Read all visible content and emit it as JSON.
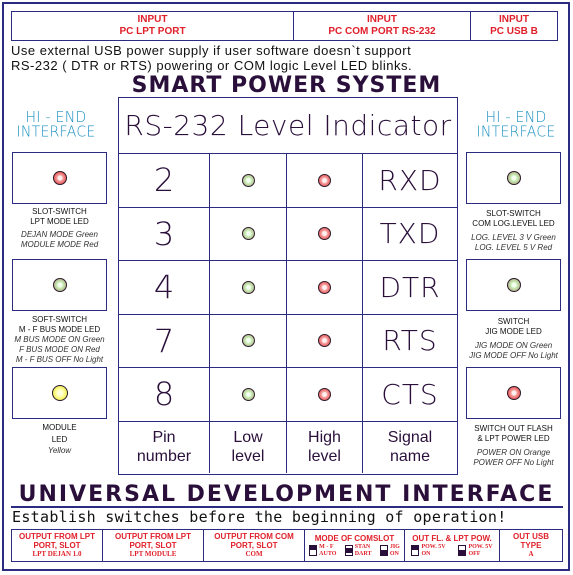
{
  "inputs": [
    {
      "line1": "INPUT",
      "line2": "PC LPT PORT"
    },
    {
      "line1": "INPUT",
      "line2": "PC  COM  PORT RS-232"
    },
    {
      "line1": "INPUT",
      "line2": "PC USB B"
    }
  ],
  "note": {
    "line1": "Use external USB power supply if user software doesn`t support",
    "line2": "RS-232 ( DTR or RTS)  powering or COM logic Level LED blinks."
  },
  "title": "SMART POWER SYSTEM",
  "brand_left": {
    "line1": "HI - END",
    "line2": "INTERFACE"
  },
  "brand_right": {
    "line1": "HI - END",
    "line2": "INTERFACE"
  },
  "left_panels": [
    {
      "led_color": "red",
      "title1": "SLOT-SWITCH",
      "title2": "LPT MODE LED",
      "desc": [
        "DEJAN MODE Green",
        "MODULE MODE Red"
      ]
    },
    {
      "led_color": "green",
      "title1": "SOFT-SWITCH",
      "title2": "M - F BUS MODE LED",
      "desc": [
        "M BUS MODE ON Green",
        "F BUS MODE ON Red",
        "M - F BUS OFF No Light"
      ]
    },
    {
      "led_color": "yellow",
      "title1": "MODULE",
      "title2": "LED",
      "desc": [
        "Yellow"
      ]
    }
  ],
  "right_panels": [
    {
      "led_color": "green",
      "title1": "SLOT-SWITCH",
      "title2": "COM LOG.LEVEL LED",
      "desc": [
        "LOG. LEVEL 3 V Green",
        "LOG. LEVEL 5 V Red"
      ]
    },
    {
      "led_color": "green",
      "title1": "SWITCH",
      "title2": "JIG MODE LED",
      "desc": [
        "JIG MODE ON  Green",
        "JIG MODE  OFF No Light"
      ]
    },
    {
      "led_color": "red",
      "title1": "SWITCH OUT FLASH",
      "title2": "& LPT POWER LED",
      "desc": [
        "POWER ON Orange",
        "POWER OFF No Light"
      ]
    }
  ],
  "indicator": {
    "title": "RS-232 Level Indicator",
    "rows": [
      {
        "pin": "2",
        "signal": "RXD"
      },
      {
        "pin": "3",
        "signal": "TXD"
      },
      {
        "pin": "4",
        "signal": "DTR"
      },
      {
        "pin": "7",
        "signal": "RTS"
      },
      {
        "pin": "8",
        "signal": "CTS"
      }
    ],
    "footer": {
      "pin": {
        "l1": "Pin",
        "l2": "number"
      },
      "low": {
        "l1": "Low",
        "l2": "level"
      },
      "high": {
        "l1": "High",
        "l2": "level"
      },
      "signal": {
        "l1": "Signal",
        "l2": "name"
      }
    }
  },
  "subtitle": "UNIVERSAL DEVELOPMENT INTERFACE",
  "warning": "Establish switches before the beginning of operation!",
  "outputs": [
    {
      "l1": "OUTPUT FROM  LPT",
      "l2": "PORT, SLOT",
      "l3": "LPT  DEJAN 1.0"
    },
    {
      "l1": "OUTPUT FROM  LPT",
      "l2": "PORT, SLOT",
      "l3": "LPT  MODULE"
    },
    {
      "l1": "OUTPUT FROM COM",
      "l2": "PORT, SLOT",
      "l3": "COM"
    },
    {
      "l1": "MODE OF COMSLOT",
      "switches": [
        {
          "a": "M - F",
          "b": "AUTO"
        },
        {
          "a": "STAN",
          "b": "DART"
        },
        {
          "a": "JIG",
          "b": "ON"
        }
      ]
    },
    {
      "l1": "OUT FL. & LPT POW.",
      "switches": [
        {
          "a": "POW. 5V",
          "b": "ON"
        },
        {
          "a": "POW. 5V",
          "b": "OFF"
        }
      ]
    },
    {
      "l1": "OUT USB",
      "l2": "TYPE",
      "l3": "A"
    }
  ]
}
